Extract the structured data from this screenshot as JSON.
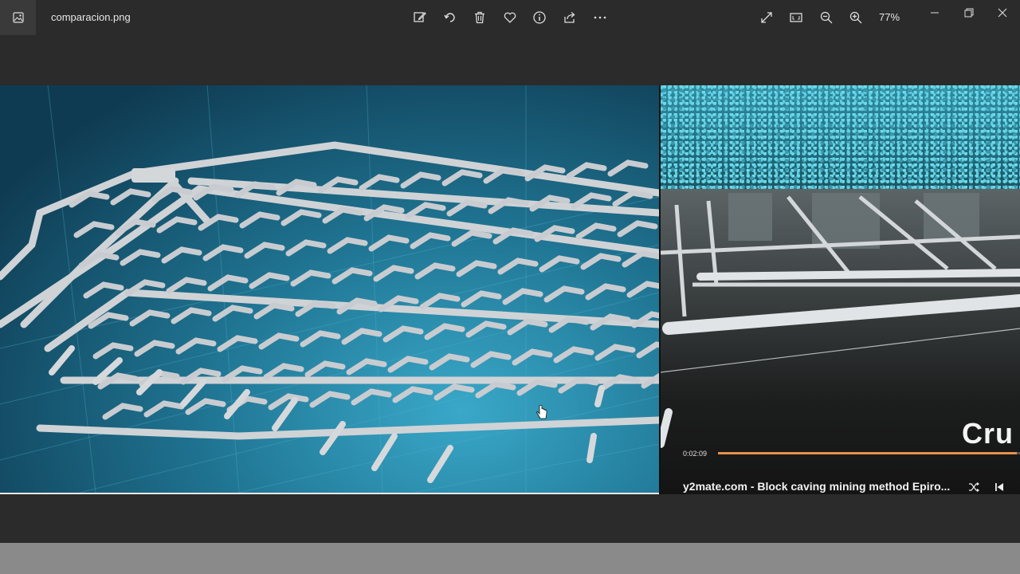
{
  "window": {
    "filename": "comparacion.png",
    "zoom": "77%"
  },
  "toolbar": {
    "tools": [
      {
        "name": "edit-image-icon"
      },
      {
        "name": "rotate-icon"
      },
      {
        "name": "delete-icon"
      },
      {
        "name": "favorite-icon"
      },
      {
        "name": "info-icon"
      },
      {
        "name": "share-icon"
      },
      {
        "name": "more-icon"
      }
    ],
    "view_tools": [
      {
        "name": "fullscreen-icon"
      },
      {
        "name": "fit-to-window-icon"
      },
      {
        "name": "zoom-out-icon"
      },
      {
        "name": "zoom-in-icon"
      }
    ]
  },
  "video": {
    "timestamp": "0:02:09",
    "progress": 0.99,
    "title": "y2mate.com - Block caving mining method  Epiro...",
    "overlay_text": "Cru"
  },
  "colors": {
    "background": "#2b2b2b",
    "progress": "#e6904a",
    "blueprint": "#1f7492"
  }
}
